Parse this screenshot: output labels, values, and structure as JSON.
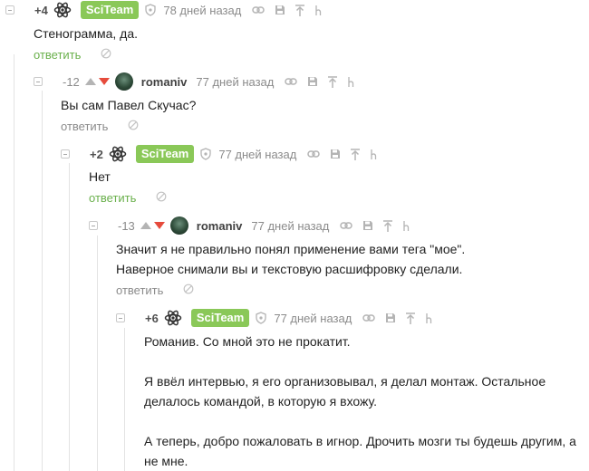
{
  "comments": [
    {
      "rating": "+4",
      "author_badge": "SciTeam",
      "date": "78 дней назад",
      "text": [
        "Стенограмма, да."
      ],
      "reply_label": "ответить"
    },
    {
      "rating": "-12",
      "author": "romaniv",
      "date": "77 дней назад",
      "text": [
        "Вы сам Павел Скучас?"
      ],
      "reply_label": "ответить"
    },
    {
      "rating": "+2",
      "author_badge": "SciTeam",
      "date": "77 дней назад",
      "text": [
        "Нет"
      ],
      "reply_label": "ответить"
    },
    {
      "rating": "-13",
      "author": "romaniv",
      "date": "77 дней назад",
      "text": [
        "Значит я не правильно понял применение вами тега \"мое\".",
        "Наверное снимали вы и текстовую расшифровку сделали."
      ],
      "reply_label": "ответить"
    },
    {
      "rating": "+6",
      "author_badge": "SciTeam",
      "date": "77 дней назад",
      "text": [
        "Романив. Со мной это не прокатит.",
        "",
        "Я ввёл интервью, я его организовывал, я делал монтаж. Остальное",
        "делалось командой, в которую я вхожу.",
        "",
        "А теперь, добро пожаловать в игнор. Дрочить мозги ты будешь другим, а",
        "не мне."
      ]
    }
  ],
  "colors": {
    "badge_green": "#8ac858",
    "reply_green": "#6ab04c",
    "downvote_red": "#e64b3c",
    "muted_grey": "#8b8b8b"
  },
  "icons": [
    "collapse-icon",
    "atom-logo-icon",
    "shield-icon",
    "link-icon",
    "save-icon",
    "pin-top-icon",
    "hand-icon",
    "hide-icon",
    "upvote-icon",
    "downvote-icon"
  ]
}
